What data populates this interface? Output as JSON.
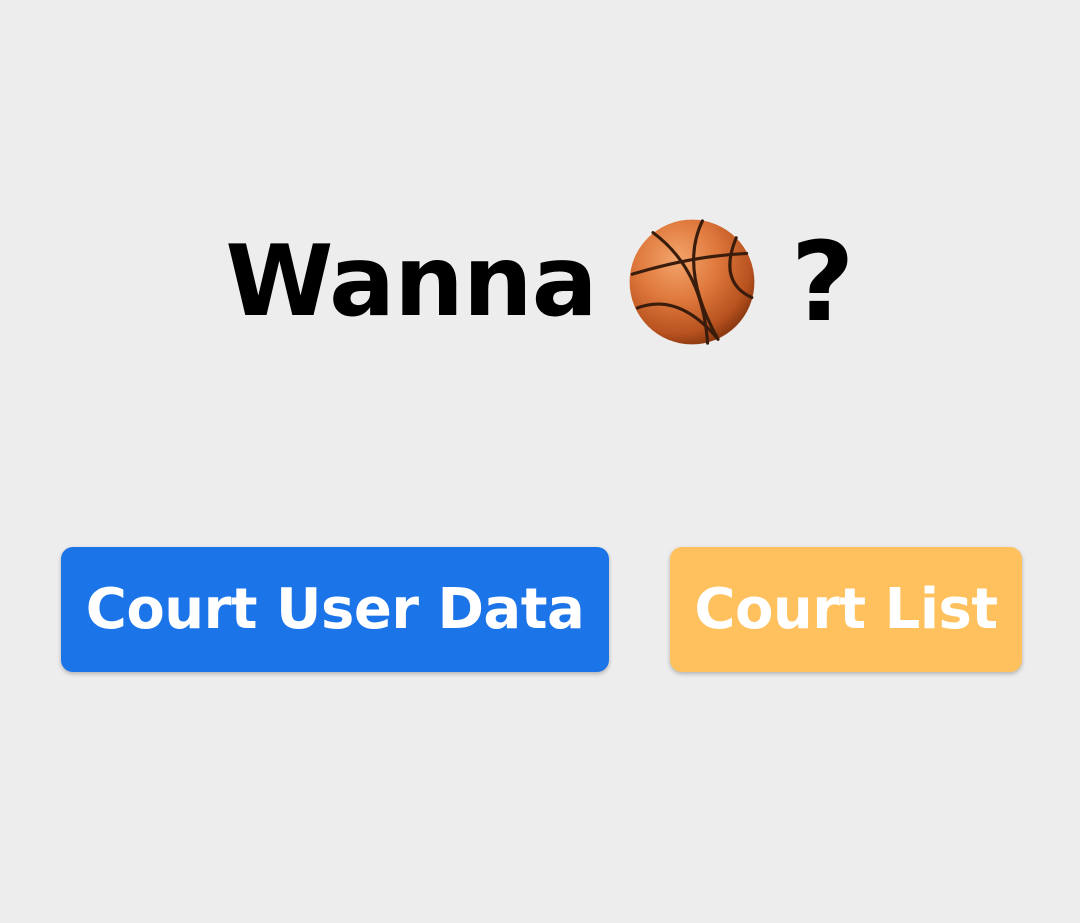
{
  "headline": {
    "word": "Wanna",
    "icon": "basketball-icon",
    "punctuation": "?"
  },
  "buttons": {
    "court_user_data": "Court User Data",
    "court_list": "Court List"
  },
  "colors": {
    "background": "#eeeded",
    "primary_button": "#1c74e9",
    "secondary_button": "#ffc15e",
    "button_text": "#ffffff",
    "headline_text": "#000000"
  }
}
